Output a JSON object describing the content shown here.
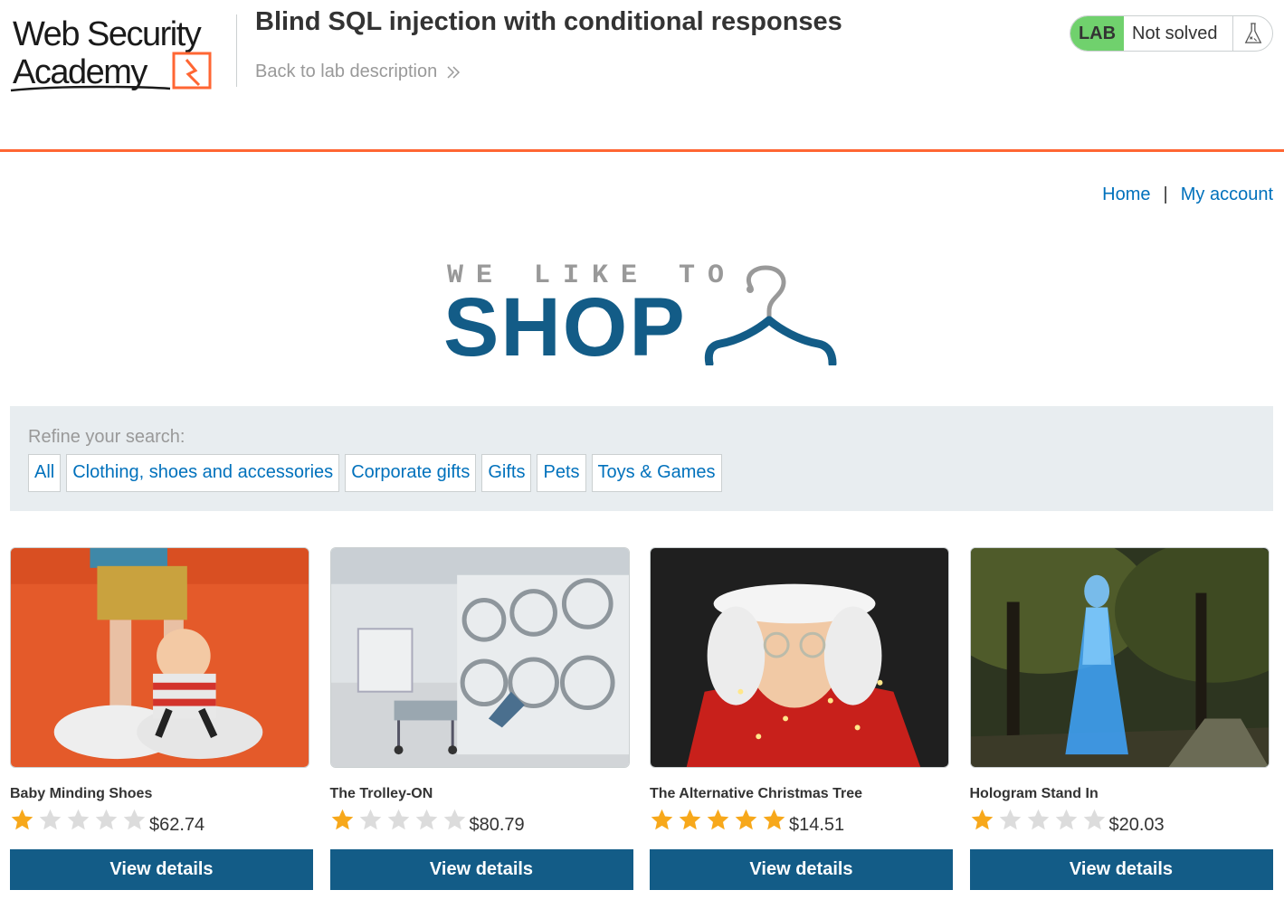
{
  "header": {
    "logo_text_line1": "Web Security",
    "logo_text_line2": "Academy",
    "lab_title": "Blind SQL injection with conditional responses",
    "back_link": "Back to lab description",
    "lab_badge": "LAB",
    "lab_status": "Not solved",
    "colors": {
      "accent": "#ff6633",
      "lab_green": "#70d16d"
    }
  },
  "nav": {
    "home": "Home",
    "separator": "|",
    "my_account": "My account"
  },
  "banner": {
    "top": "WE LIKE TO",
    "main": "SHOP",
    "icon": "hanger-icon"
  },
  "filter": {
    "label": "Refine your search:",
    "categories": [
      "All",
      "Clothing, shoes and accessories",
      "Corporate gifts",
      "Gifts",
      "Pets",
      "Toys & Games"
    ]
  },
  "products": [
    {
      "name": "Baby Minding Shoes",
      "rating": 1,
      "max_rating": 5,
      "price": "$62.74",
      "button": "View details"
    },
    {
      "name": "The Trolley-ON",
      "rating": 1,
      "max_rating": 5,
      "price": "$80.79",
      "button": "View details"
    },
    {
      "name": "The Alternative Christmas Tree",
      "rating": 5,
      "max_rating": 5,
      "price": "$14.51",
      "button": "View details"
    },
    {
      "name": "Hologram Stand In",
      "rating": 1,
      "max_rating": 5,
      "price": "$20.03",
      "button": "View details"
    }
  ]
}
